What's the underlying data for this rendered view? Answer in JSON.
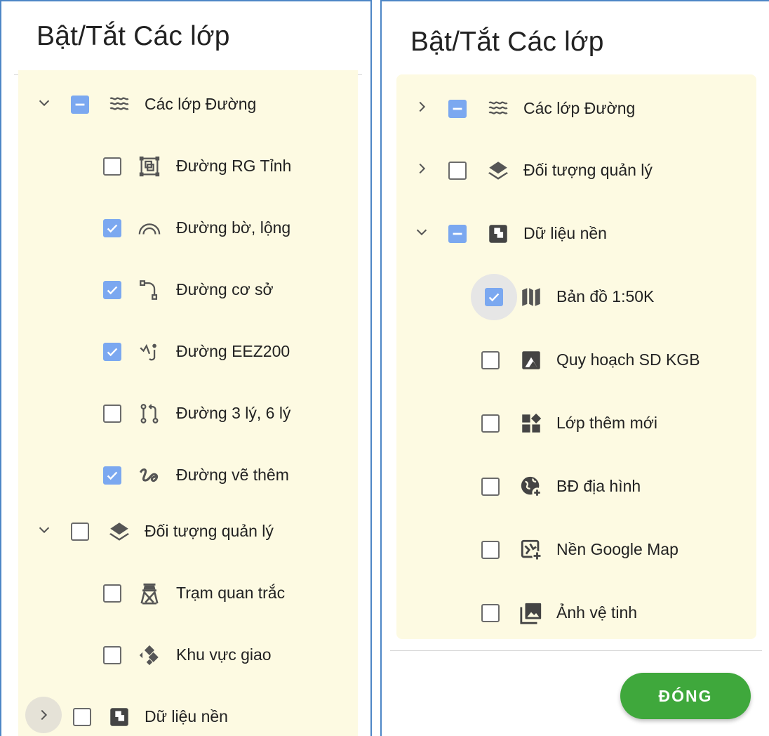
{
  "left_panel": {
    "title": "Bật/Tắt Các lớp",
    "items": [
      {
        "label": "Các lớp Đường"
      },
      {
        "label": "Đường RG Tỉnh"
      },
      {
        "label": "Đường bờ, lộng"
      },
      {
        "label": "Đường cơ sở"
      },
      {
        "label": "Đường EEZ200"
      },
      {
        "label": "Đường 3 lý, 6 lý"
      },
      {
        "label": "Đường vẽ thêm"
      },
      {
        "label": "Đối tượng quản lý"
      },
      {
        "label": "Trạm quan trắc"
      },
      {
        "label": "Khu vực giao"
      },
      {
        "label": "Dữ liệu nền"
      }
    ]
  },
  "right_panel": {
    "title": "Bật/Tắt Các lớp",
    "items": [
      {
        "label": "Các lớp Đường"
      },
      {
        "label": "Đối tượng quản lý"
      },
      {
        "label": "Dữ liệu nền"
      },
      {
        "label": "Bản đồ 1:50K"
      },
      {
        "label": "Quy hoạch SD KGB"
      },
      {
        "label": "Lớp thêm mới"
      },
      {
        "label": "BĐ địa hình"
      },
      {
        "label": "Nền Google Map"
      },
      {
        "label": "Ảnh vệ tinh"
      }
    ],
    "close_label": "ĐÓNG"
  },
  "colors": {
    "checkbox_checked": "#7ba8f0",
    "tree_background": "#fdfae2",
    "close_button": "#3fa83c",
    "panel_border": "#4d86c6"
  }
}
